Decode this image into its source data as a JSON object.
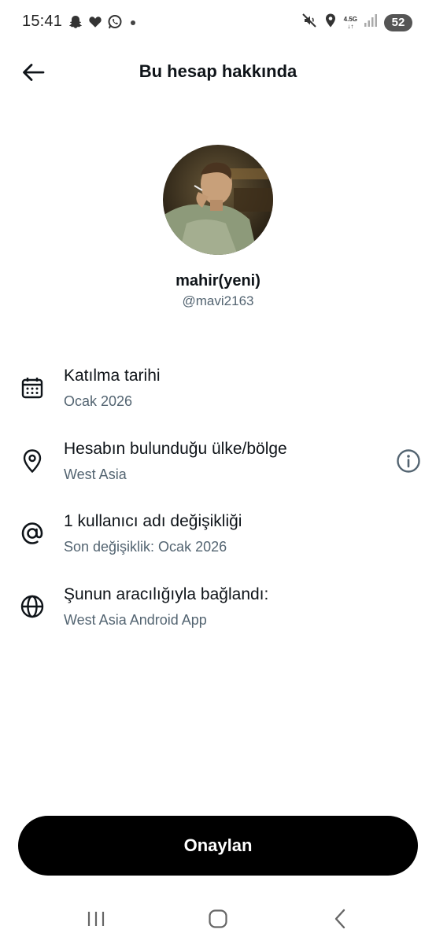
{
  "status_bar": {
    "time": "15:41",
    "left_icons": [
      "snapchat-icon",
      "heart-icon",
      "whatsapp-icon",
      "dot-icon"
    ],
    "network_label": "4.5G",
    "battery": "52"
  },
  "header": {
    "title": "Bu hesap hakkında",
    "back_icon": "arrow-left-icon"
  },
  "profile": {
    "display_name": "mahir(yeni)",
    "handle": "@mavi2163"
  },
  "rows": [
    {
      "icon": "calendar-icon",
      "title": "Katılma tarihi",
      "subtitle": "Ocak 2026"
    },
    {
      "icon": "location-pin-icon",
      "title": "Hesabın bulunduğu ülke/bölge",
      "subtitle": "West Asia",
      "action_icon": "info-icon"
    },
    {
      "icon": "at-sign-icon",
      "title": "1 kullanıcı adı değişikliği",
      "subtitle": "Son değişiklik: Ocak 2026"
    },
    {
      "icon": "globe-icon",
      "title": "Şunun aracılığıyla bağlandı:",
      "subtitle": "West Asia Android App"
    }
  ],
  "confirm_button": {
    "label": "Onaylan"
  },
  "nav_bar": {
    "items": [
      "recent-apps-icon",
      "home-icon",
      "back-icon"
    ]
  },
  "colors": {
    "text_primary": "#0f1419",
    "text_secondary": "#536471",
    "button_bg": "#000000",
    "button_text": "#ffffff"
  }
}
